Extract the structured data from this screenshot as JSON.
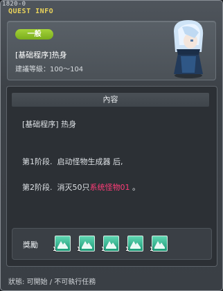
{
  "window": {
    "id_text": "1820-0",
    "title": "QUEST INFO"
  },
  "quest": {
    "category_badge": "一般",
    "name": "[基础程序]热身",
    "level": "建議等級：100～104"
  },
  "content": {
    "header": "內容",
    "lines": {
      "title": "[基础程序] 热身",
      "stage1": "第1阶段.  启动怪物生成器 后,",
      "stage2_prefix": "第2阶段.  消灭50只",
      "stage2_highlight": "系统怪物01",
      "stage2_suffix": " 。"
    }
  },
  "rewards": {
    "label": "獎勵",
    "items": [
      {
        "icon": "reward-item-icon",
        "qty": "1"
      },
      {
        "icon": "reward-item-icon",
        "qty": "1"
      },
      {
        "icon": "reward-item-icon",
        "qty": "1"
      },
      {
        "icon": "reward-item-icon",
        "qty": "1"
      },
      {
        "icon": "reward-item-icon",
        "qty": "1"
      }
    ]
  },
  "status": "狀態:  可開始 / 不可執行任務",
  "colors": {
    "title": "#e8d25a",
    "badge": "#8cc02a",
    "highlight": "#ff3c78",
    "reward_icon": "#2fb58d"
  }
}
